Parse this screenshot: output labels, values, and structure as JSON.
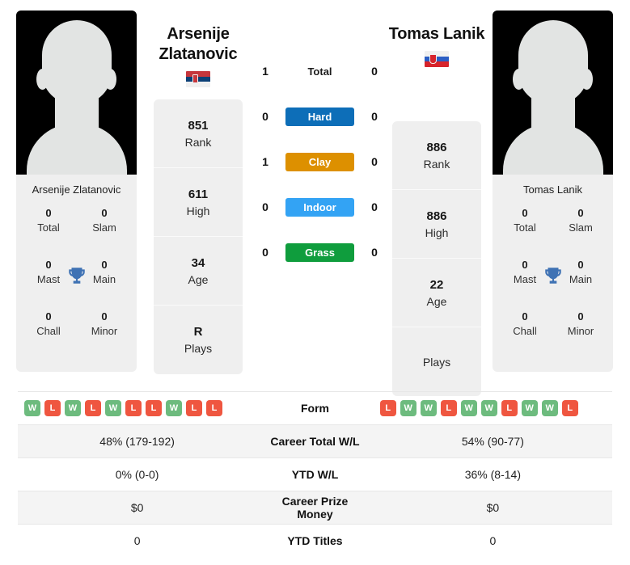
{
  "players": {
    "left": {
      "first_name": "Arsenije",
      "last_name": "Zlatanovic",
      "full_name": "Arsenije Zlatanovic",
      "country": "Serbia",
      "flag_icon": "serbia-flag-icon",
      "rank": "851",
      "rank_label": "Rank",
      "high": "611",
      "high_label": "High",
      "age": "34",
      "age_label": "Age",
      "plays": "R",
      "plays_label": "Plays",
      "titles": {
        "total": "0",
        "total_label": "Total",
        "slam": "0",
        "slam_label": "Slam",
        "mast": "0",
        "mast_label": "Mast",
        "main": "0",
        "main_label": "Main",
        "chall": "0",
        "chall_label": "Chall",
        "minor": "0",
        "minor_label": "Minor"
      },
      "form": [
        "W",
        "L",
        "W",
        "L",
        "W",
        "L",
        "L",
        "W",
        "L",
        "L"
      ],
      "career_total_wl": "48% (179-192)",
      "ytd_wl": "0% (0-0)",
      "career_prize_money": "$0",
      "ytd_titles": "0"
    },
    "right": {
      "first_name": "Tomas",
      "last_name": "Lanik",
      "full_name": "Tomas Lanik",
      "country": "Slovakia",
      "flag_icon": "slovakia-flag-icon",
      "rank": "886",
      "rank_label": "Rank",
      "high": "886",
      "high_label": "High",
      "age": "22",
      "age_label": "Age",
      "plays": "",
      "plays_label": "Plays",
      "titles": {
        "total": "0",
        "total_label": "Total",
        "slam": "0",
        "slam_label": "Slam",
        "mast": "0",
        "mast_label": "Mast",
        "main": "0",
        "main_label": "Main",
        "chall": "0",
        "chall_label": "Chall",
        "minor": "0",
        "minor_label": "Minor"
      },
      "form": [
        "L",
        "W",
        "W",
        "L",
        "W",
        "W",
        "L",
        "W",
        "W",
        "L"
      ],
      "career_total_wl": "54% (90-77)",
      "ytd_wl": "36% (8-14)",
      "career_prize_money": "$0",
      "ytd_titles": "0"
    }
  },
  "head_to_head": {
    "rows": [
      {
        "label": "Total",
        "left": "1",
        "right": "0",
        "style": "plain",
        "color": ""
      },
      {
        "label": "Hard",
        "left": "0",
        "right": "0",
        "style": "badge",
        "color": "#0d6eb8"
      },
      {
        "label": "Clay",
        "left": "1",
        "right": "0",
        "style": "badge",
        "color": "#dd9000"
      },
      {
        "label": "Indoor",
        "left": "0",
        "right": "0",
        "style": "badge",
        "color": "#33a3f4"
      },
      {
        "label": "Grass",
        "left": "0",
        "right": "0",
        "style": "badge",
        "color": "#0f9d3d"
      }
    ]
  },
  "comparison_table": {
    "rows": [
      {
        "label": "Form",
        "key": "form"
      },
      {
        "label": "Career Total W/L",
        "key": "career_total_wl"
      },
      {
        "label": "YTD W/L",
        "key": "ytd_wl"
      },
      {
        "label": "Career Prize Money",
        "key": "career_prize_money"
      },
      {
        "label": "YTD Titles",
        "key": "ytd_titles"
      }
    ]
  },
  "colors": {
    "win_badge": "#6dbb7e",
    "loss_badge": "#ef5640",
    "card_background": "#efefef",
    "stripe": "#f4f4f4",
    "trophy": "#3f72b4"
  }
}
